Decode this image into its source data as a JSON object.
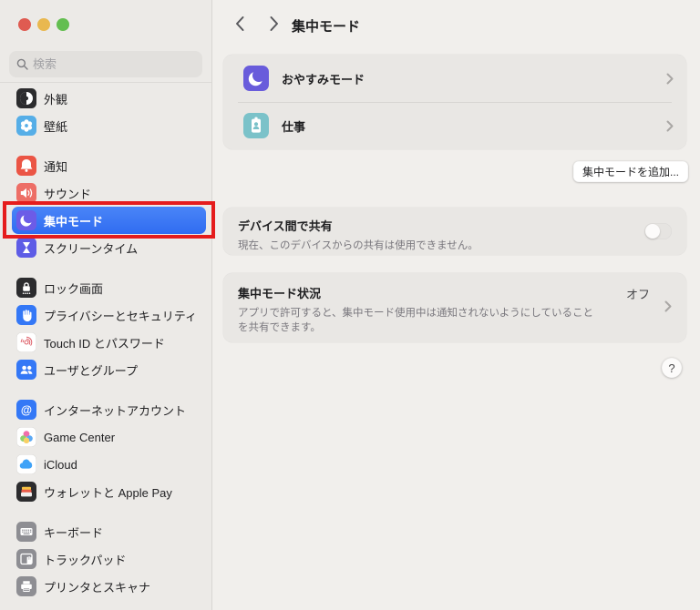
{
  "colors": {
    "accent_blue": "#3478F6",
    "selection_blue": "#306CF1",
    "annotation_red": "#E51C1C",
    "traffic_red": "#DF5B51",
    "traffic_yellow": "#E9B84F",
    "traffic_green": "#63BE50"
  },
  "sidebar": {
    "search_placeholder": "検索",
    "groups": [
      {
        "items": [
          {
            "label": "外観",
            "icon": "appearance-icon"
          },
          {
            "label": "壁紙",
            "icon": "wallpaper-icon"
          }
        ]
      },
      {
        "items": [
          {
            "label": "通知",
            "icon": "notifications-icon"
          },
          {
            "label": "サウンド",
            "icon": "sound-icon"
          },
          {
            "label": "集中モード",
            "icon": "focus-moon-icon",
            "selected": true
          },
          {
            "label": "スクリーンタイム",
            "icon": "screen-time-icon"
          }
        ]
      },
      {
        "items": [
          {
            "label": "ロック画面",
            "icon": "lock-screen-icon"
          },
          {
            "label": "プライバシーとセキュリティ",
            "icon": "privacy-hand-icon"
          },
          {
            "label": "Touch ID とパスワード",
            "icon": "touch-id-icon"
          },
          {
            "label": "ユーザとグループ",
            "icon": "users-groups-icon"
          }
        ]
      },
      {
        "items": [
          {
            "label": "インターネットアカウント",
            "icon": "internet-accounts-icon"
          },
          {
            "label": "Game Center",
            "icon": "game-center-icon"
          },
          {
            "label": "iCloud",
            "icon": "icloud-icon"
          },
          {
            "label": "ウォレットと Apple Pay",
            "icon": "wallet-icon"
          }
        ]
      },
      {
        "items": [
          {
            "label": "キーボード",
            "icon": "keyboard-icon"
          },
          {
            "label": "トラックパッド",
            "icon": "trackpad-icon"
          },
          {
            "label": "プリンタとスキャナ",
            "icon": "printer-icon"
          }
        ]
      }
    ]
  },
  "header": {
    "title": "集中モード"
  },
  "main": {
    "focus_modes": [
      {
        "label": "おやすみモード",
        "icon": "do-not-disturb-moon-icon"
      },
      {
        "label": "仕事",
        "icon": "work-badge-icon"
      }
    ],
    "add_button_label": "集中モードを追加...",
    "share_section": {
      "title": "デバイス間で共有",
      "subtitle": "現在、このデバイスからの共有は使用できません。",
      "toggle_state": "off"
    },
    "status_section": {
      "title": "集中モード状況",
      "value": "オフ",
      "subtitle_line1": "アプリで許可すると、集中モード使用中は通知されないようにしていること",
      "subtitle_line2": "を共有できます。"
    },
    "help_label": "?"
  }
}
